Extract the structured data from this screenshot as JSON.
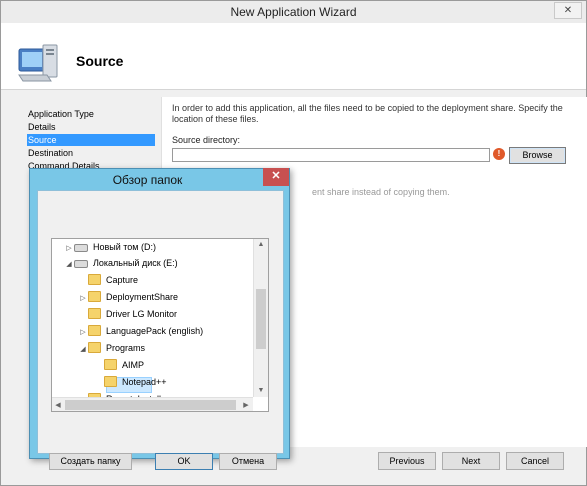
{
  "wizard": {
    "title": "New Application Wizard",
    "close_glyph": "✕",
    "header_title": "Source",
    "nav": [
      {
        "label": "Application Type"
      },
      {
        "label": "Details"
      },
      {
        "label": "Source"
      },
      {
        "label": "Destination"
      },
      {
        "label": "Command Details"
      }
    ],
    "selected_nav": "Source",
    "instructions": "In order to add this application, all the files need to be copied to the deployment share.  Specify the location of these files.",
    "source_dir_label": "Source directory:",
    "source_dir_value": "",
    "error_glyph": "!",
    "browse_label": "Browse",
    "move_text_partial": "ent share instead of copying them.",
    "buttons": {
      "previous": "Previous",
      "next": "Next",
      "cancel": "Cancel"
    }
  },
  "dialog": {
    "title": "Обзор папок",
    "close_glyph": "✕",
    "tree": [
      {
        "label": "Новый том (D:)",
        "type": "drive",
        "expander": "▷"
      },
      {
        "label": "Локальный диск (E:)",
        "type": "drive",
        "expander": "◢"
      },
      {
        "label": "Capture",
        "type": "folder",
        "expander": ""
      },
      {
        "label": "DeploymentShare",
        "type": "folder",
        "expander": "▷"
      },
      {
        "label": "Driver LG Monitor",
        "type": "folder",
        "expander": ""
      },
      {
        "label": "LanguagePack (english)",
        "type": "folder",
        "expander": "▷"
      },
      {
        "label": "Programs",
        "type": "folder",
        "expander": "◢"
      },
      {
        "label": "AIMP",
        "type": "folder",
        "expander": ""
      },
      {
        "label": "Notepad++",
        "type": "folder",
        "expander": ""
      },
      {
        "label": "RemoteInstall",
        "type": "folder",
        "expander": "▷"
      }
    ],
    "selected_folder": "AIMP",
    "buttons": {
      "new_folder": "Создать папку",
      "ok": "OK",
      "cancel": "Отмена"
    }
  },
  "colors": {
    "selection": "#3399ff",
    "dialog_frame": "#79c7e7",
    "dialog_close": "#c75050",
    "error_icon": "#e0592a"
  }
}
